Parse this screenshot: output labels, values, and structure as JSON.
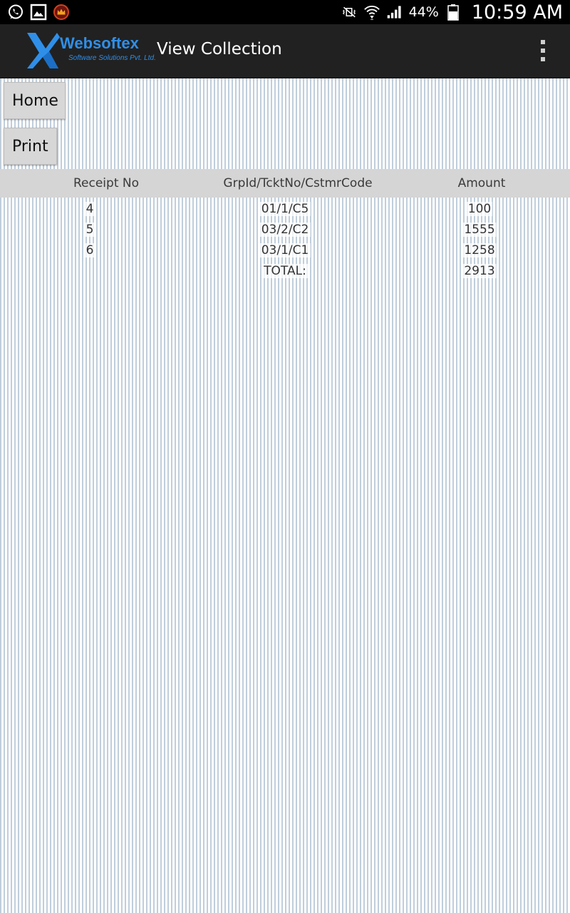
{
  "status_bar": {
    "left_icons": [
      "whatsapp-icon",
      "gallery-icon",
      "crown-app-icon"
    ],
    "right_icons": [
      "mute-vibrate-icon",
      "wifi-icon",
      "signal-icon",
      "battery-icon"
    ],
    "battery_percent": "44%",
    "time": "10:59 AM"
  },
  "app_bar": {
    "logo_name": "Websoftex",
    "logo_subtitle": "Software Solutions Pvt. Ltd.",
    "title": "View Collection",
    "menu_icon": "overflow-menu-icon"
  },
  "buttons": {
    "home": "Home",
    "print": "Print"
  },
  "table": {
    "headers": [
      "Receipt No",
      "GrpId/TcktNo/CstmrCode",
      "Amount"
    ],
    "rows": [
      [
        "4",
        "01/1/C5",
        "100"
      ],
      [
        "5",
        "03/2/C2",
        "1555"
      ],
      [
        "6",
        "03/1/C1",
        "1258"
      ]
    ],
    "total_label": "TOTAL:",
    "total_value": "2913"
  },
  "colors": {
    "status_bar_bg": "#000000",
    "app_bar_bg": "#212121",
    "brand_blue": "#2f8fe8",
    "header_row_bg": "#d5d5d5",
    "button_bg": "#d7d7d7"
  }
}
